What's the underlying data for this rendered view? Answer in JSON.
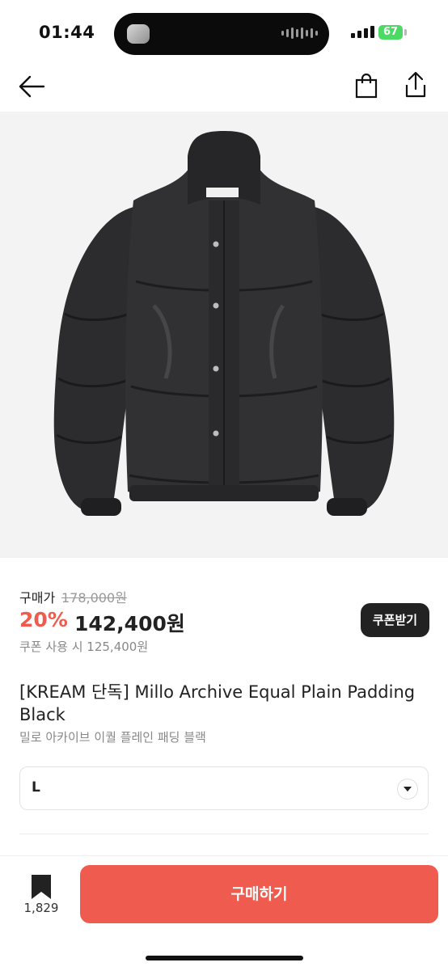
{
  "status_bar": {
    "time": "01:44",
    "battery": "67"
  },
  "price": {
    "label": "구매가",
    "original": "178,000원",
    "discount": "20%",
    "sale": "142,400원",
    "coupon_price": "쿠폰 사용 시 125,400원",
    "coupon_button": "쿠폰받기"
  },
  "product": {
    "title": "[KREAM 단독] Millo Archive Equal Plain Padding Black",
    "subtitle": "밀로 아카이브 이퀄 플레인 패딩 블랙",
    "label_tag": "Millo Archive"
  },
  "size_select": {
    "value": "L"
  },
  "bottom_bar": {
    "bookmark_count": "1,829",
    "buy_label": "구매하기"
  },
  "colors": {
    "accent": "#ef5c4f",
    "dark": "#222222"
  },
  "icons": [
    "back-arrow-icon",
    "shopping-bag-icon",
    "share-icon",
    "chevron-down-icon",
    "bookmark-icon"
  ]
}
